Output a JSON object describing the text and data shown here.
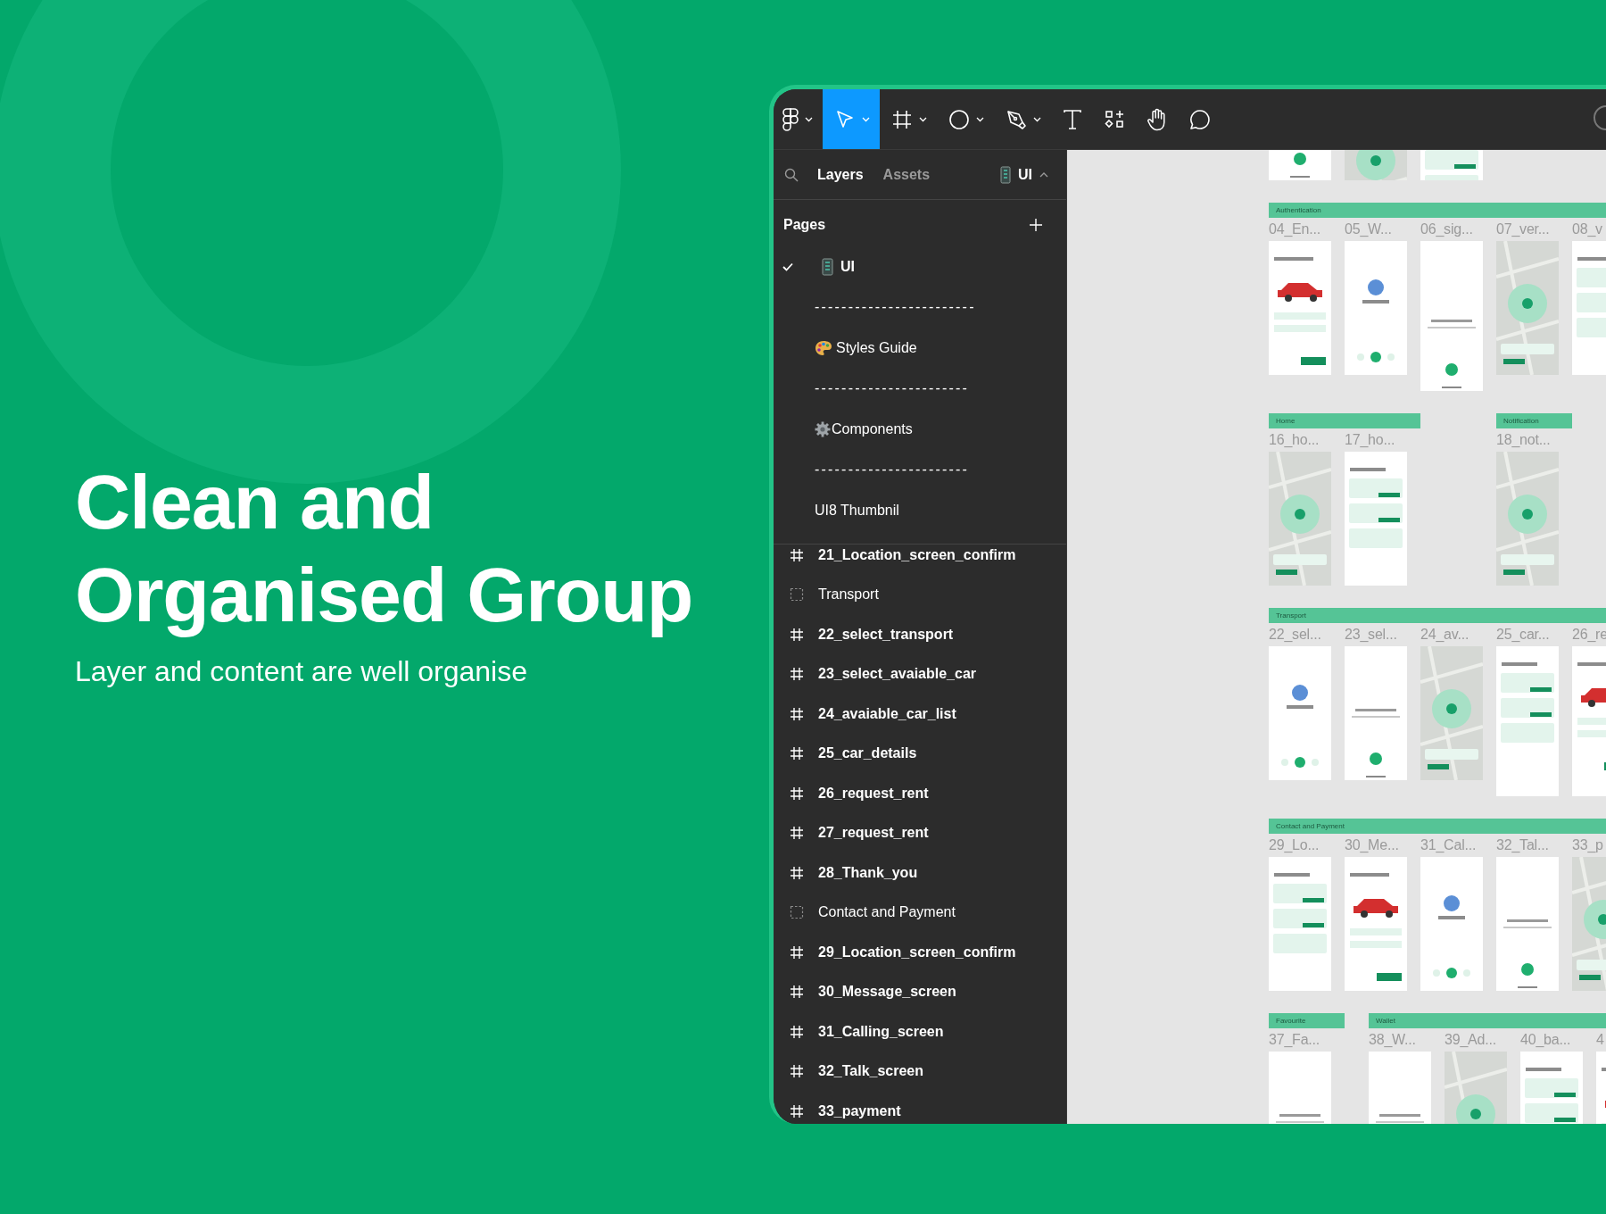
{
  "hero": {
    "title_lines": [
      "Clean and",
      "Organised Group"
    ],
    "subtitle": "Layer and content are well organise"
  },
  "toolbar": {
    "tools": [
      {
        "kind": "logo",
        "selected": false,
        "has_menu": true
      },
      {
        "kind": "move",
        "selected": true,
        "has_menu": true
      },
      {
        "kind": "frame",
        "selected": false,
        "has_menu": true
      },
      {
        "kind": "ellipse",
        "selected": false,
        "has_menu": true
      },
      {
        "kind": "pen",
        "selected": false,
        "has_menu": true
      },
      {
        "kind": "text",
        "selected": false,
        "has_menu": false
      },
      {
        "kind": "resources",
        "selected": false,
        "has_menu": false
      },
      {
        "kind": "hand",
        "selected": false,
        "has_menu": false
      },
      {
        "kind": "comment",
        "selected": false,
        "has_menu": false
      }
    ]
  },
  "sidebar": {
    "tabs": [
      {
        "label": "Layers",
        "selected": true
      },
      {
        "label": "Assets",
        "selected": false
      }
    ],
    "page_selector": {
      "label": "UI"
    },
    "pages_title": "Pages",
    "pages": [
      {
        "label": "UI",
        "kind": "page",
        "selected": true
      },
      {
        "label": "------------------------",
        "kind": "separator",
        "selected": false
      },
      {
        "label": "Styles Guide",
        "kind": "page",
        "selected": false
      },
      {
        "label": "-----------------------",
        "kind": "separator",
        "selected": false
      },
      {
        "label": "Components",
        "kind": "page",
        "selected": false
      },
      {
        "label": "-----------------------",
        "kind": "separator",
        "selected": false
      },
      {
        "label": "UI8 Thumbnil",
        "kind": "page",
        "selected": false
      }
    ],
    "layers": [
      {
        "kind": "frame",
        "label": "21_Location_screen_confirm"
      },
      {
        "kind": "section",
        "label": "Transport"
      },
      {
        "kind": "frame",
        "label": "22_select_transport"
      },
      {
        "kind": "frame",
        "label": "23_select_avaiable_car"
      },
      {
        "kind": "frame",
        "label": "24_avaiable_car_list"
      },
      {
        "kind": "frame",
        "label": "25_car_details"
      },
      {
        "kind": "frame",
        "label": "26_request_rent"
      },
      {
        "kind": "frame",
        "label": "27_request_rent"
      },
      {
        "kind": "frame",
        "label": "28_Thank_you"
      },
      {
        "kind": "section",
        "label": "Contact and Payment"
      },
      {
        "kind": "frame",
        "label": "29_Location_screen_confirm"
      },
      {
        "kind": "frame",
        "label": "30_Message_screen"
      },
      {
        "kind": "frame",
        "label": "31_Calling_screen"
      },
      {
        "kind": "frame",
        "label": "32_Talk_screen"
      },
      {
        "kind": "frame",
        "label": "33_payment"
      }
    ]
  },
  "canvas": {
    "sections": [
      {
        "groups": [
          {
            "frames": [
              {
                "kind": "cut"
              },
              {
                "kind": "cut"
              },
              {
                "kind": "cut"
              }
            ]
          }
        ]
      },
      {
        "groups": [
          {
            "title": "Authentication",
            "frames": [
              {
                "label": "04_En...",
                "kind": "screen"
              },
              {
                "label": "05_W...",
                "kind": "screen"
              },
              {
                "label": "06_sig...",
                "kind": "long"
              },
              {
                "label": "07_ver...",
                "kind": "screen"
              },
              {
                "label": "08_v",
                "kind": "screen"
              }
            ]
          }
        ]
      },
      {
        "groups": [
          {
            "title": "Home",
            "frames": [
              {
                "label": "16_ho...",
                "kind": "screen"
              },
              {
                "label": "17_ho...",
                "kind": "screen"
              }
            ]
          },
          {
            "title": "Notification",
            "frames": [
              {
                "label": "18_not...",
                "kind": "screen"
              }
            ]
          }
        ]
      },
      {
        "groups": [
          {
            "title": "Transport",
            "frames": [
              {
                "label": "22_sel...",
                "kind": "screen"
              },
              {
                "label": "23_sel...",
                "kind": "screen"
              },
              {
                "label": "24_av...",
                "kind": "screen"
              },
              {
                "label": "25_car...",
                "kind": "long"
              },
              {
                "label": "26_re",
                "kind": "long"
              }
            ]
          }
        ]
      },
      {
        "groups": [
          {
            "title": "Contact and Payment",
            "frames": [
              {
                "label": "29_Lo...",
                "kind": "screen"
              },
              {
                "label": "30_Me...",
                "kind": "screen"
              },
              {
                "label": "31_Cal...",
                "kind": "screen"
              },
              {
                "label": "32_Tal...",
                "kind": "screen"
              },
              {
                "label": "33_p",
                "kind": "screen"
              }
            ]
          }
        ]
      },
      {
        "groups": [
          {
            "title": "Favourite",
            "frames": [
              {
                "label": "37_Fa...",
                "kind": "screen"
              }
            ]
          },
          {
            "title": "Wallet",
            "frames": [
              {
                "label": "38_W...",
                "kind": "screen"
              },
              {
                "label": "39_Ad...",
                "kind": "screen"
              },
              {
                "label": "40_ba...",
                "kind": "screen"
              },
              {
                "label": "4",
                "kind": "screen"
              }
            ]
          }
        ]
      }
    ]
  }
}
